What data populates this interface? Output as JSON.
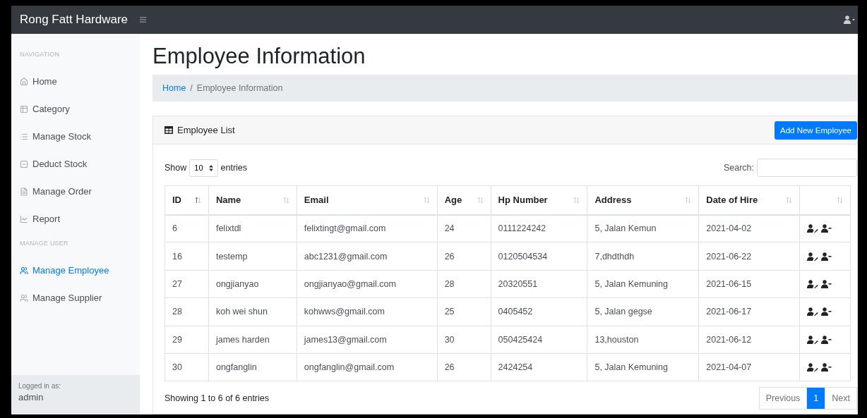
{
  "brand": "Rong Fatt Hardware",
  "sidebar": {
    "sections": [
      {
        "heading": "NAVIGATION",
        "items": [
          {
            "label": "Home",
            "selected": false
          },
          {
            "label": "Category",
            "selected": false
          },
          {
            "label": "Manage Stock",
            "selected": false
          },
          {
            "label": "Deduct Stock",
            "selected": false
          },
          {
            "label": "Manage Order",
            "selected": false
          },
          {
            "label": "Report",
            "selected": false
          }
        ]
      },
      {
        "heading": "MANAGE USER",
        "items": [
          {
            "label": "Manage Employee",
            "selected": true
          },
          {
            "label": "Manage Supplier",
            "selected": false
          }
        ]
      }
    ],
    "footer": {
      "caption": "Logged in as:",
      "user": "admin"
    }
  },
  "page_title": "Employee Information",
  "breadcrumb": {
    "separator": "/",
    "items": [
      "Home",
      "Employee Information"
    ]
  },
  "card": {
    "title": "Employee List",
    "add_button": "Add New Employee",
    "length": {
      "before": "Show",
      "value": "10",
      "after": "entries"
    },
    "search_label": "Search:",
    "table": {
      "columns": [
        {
          "label": "ID",
          "sorted": true
        },
        {
          "label": "Name",
          "sorted": false
        },
        {
          "label": "Email",
          "sorted": false
        },
        {
          "label": "Age",
          "sorted": false
        },
        {
          "label": "Hp Number",
          "sorted": false
        },
        {
          "label": "Address",
          "sorted": false
        },
        {
          "label": "Date of Hire",
          "sorted": false
        },
        {
          "sorted": false
        }
      ],
      "rows": [
        [
          "6",
          "felixtdl",
          "felixtingt@gmail.com",
          "24",
          "0111224242",
          "5, Jalan Kemun",
          "2021-04-02"
        ],
        [
          "16",
          "testemp",
          "abc1231@gmail.com",
          "26",
          "0120504534",
          "7,dhdthdh",
          "2021-06-22"
        ],
        [
          "27",
          "ongjianyao",
          "ongjianyao@gmail.com",
          "28",
          "20320551",
          "5, Jalan Kemuning",
          "2021-06-15"
        ],
        [
          "28",
          "koh wei shun",
          "kohwws@gmail.com",
          "25",
          "0405452",
          "5, Jalan gegse",
          "2021-06-17"
        ],
        [
          "29",
          "james harden",
          "james13@gmail.com",
          "30",
          "050425424",
          "13,houston",
          "2021-06-12"
        ],
        [
          "30",
          "ongfanglin",
          "ongfanglin@gmail.com",
          "26",
          "2424254",
          "5, Jalan Kemuning",
          "2021-04-07"
        ]
      ]
    },
    "info": "Showing 1 to 6 of 6 entries",
    "pagination": [
      {
        "label": "Previous",
        "selected": false
      },
      {
        "label": "1",
        "selected": true
      },
      {
        "label": "Next",
        "selected": false
      }
    ]
  }
}
